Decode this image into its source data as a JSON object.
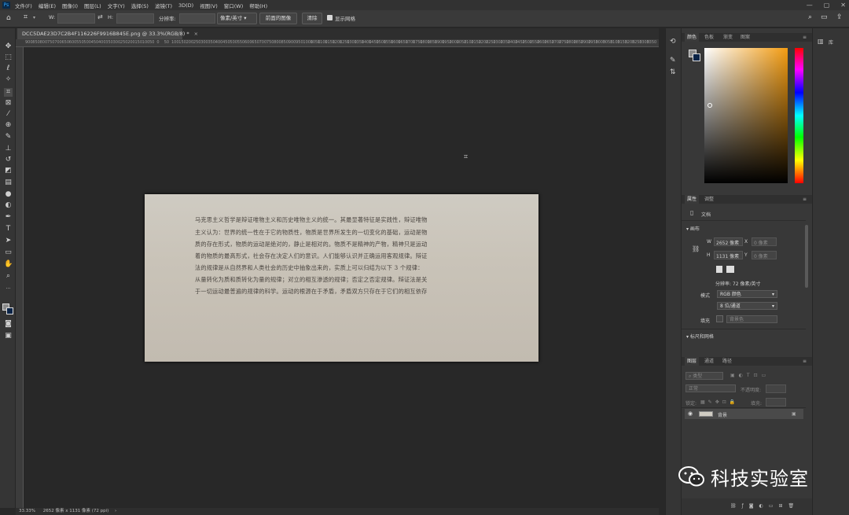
{
  "menu": {
    "items": [
      "文件(F)",
      "编辑(E)",
      "图像(I)",
      "图层(L)",
      "文字(Y)",
      "选择(S)",
      "滤镜(T)",
      "3D(D)",
      "视图(V)",
      "窗口(W)",
      "帮助(H)"
    ]
  },
  "options": {
    "w_label": "W:",
    "h_label": "H:",
    "resolution_label": "分辨率:",
    "unit_select": "像素/英寸",
    "front_image_button": "前面的图像",
    "clear_button": "清除",
    "show_grid_label": "显示网格"
  },
  "document": {
    "tab_title": "DCC5DAE23D7C2B4F116226F9916B845E.png @ 33.3%(RGB/8) *",
    "lines": [
      "马克思主义哲学是辩证唯物主义和历史唯物主义的统一。其最显著特征是实践性，辩证唯物",
      "主义认为：世界的统一性在于它的物质性，物质是世界所发生的一切变化的基础，运动是物",
      "质的存在形式，物质的运动是绝对的，静止是相对的。物质不是精神的产物，精神只是运动",
      "着的物质的最高形式，社会存在决定人们的意识。人们能够认识并正确运用客观规律。辩证",
      "法的规律是从自然界和人类社会的历史中抽象出来的，实质上可以归结为以下 3 个规律：",
      "从量转化为质和质转化为量的规律；对立的相互渗透的规律；否定之否定规律。辩证法是关",
      "于一切运动最普遍的规律的科学。运动的根源在于矛盾，矛盾双方只存在于它们的相互依存"
    ]
  },
  "ruler_ticks": [
    "900",
    "850",
    "800",
    "750",
    "700",
    "650",
    "600",
    "550",
    "500",
    "450",
    "400",
    "350",
    "300",
    "250",
    "200",
    "150",
    "100",
    "50",
    "0",
    "50",
    "100",
    "150",
    "200",
    "250",
    "300",
    "350",
    "400",
    "450",
    "500",
    "550",
    "600",
    "650",
    "700",
    "750",
    "800",
    "850",
    "900",
    "950",
    "1000",
    "1050",
    "1100",
    "1150",
    "1200",
    "1250",
    "1300",
    "1350",
    "1400",
    "1450",
    "1500",
    "1550",
    "1600",
    "1650",
    "1700",
    "1750",
    "1800",
    "1850",
    "1900",
    "1950",
    "2000",
    "2050",
    "2100",
    "2150",
    "2200",
    "2250",
    "2300",
    "2350",
    "2400",
    "2450",
    "2500",
    "2550",
    "2600",
    "2650",
    "2700",
    "2750",
    "2800",
    "2850",
    "2900",
    "2950",
    "3000",
    "3050",
    "3100",
    "3150",
    "3200",
    "3250",
    "3300",
    "3350",
    "3400",
    "3450",
    "3500",
    "3550",
    "3600"
  ],
  "status": {
    "zoom": "33.33%",
    "doc_size": "2652 像素 x 1131 像素 (72 ppi)"
  },
  "color_panel": {
    "tabs": [
      "颜色",
      "色板",
      "渐变",
      "图案"
    ]
  },
  "properties_panel": {
    "tabs": [
      "属性",
      "调整"
    ],
    "doc_label": "文档",
    "canvas_section": "画布",
    "w_label": "W",
    "w_value": "2652 像素",
    "x_label": "X",
    "x_placeholder": "0 像素",
    "h_label": "H",
    "h_value": "1131 像素",
    "y_label": "Y",
    "y_placeholder": "0 像素",
    "resolution": "分辨率: 72 像素/英寸",
    "mode_label": "模式",
    "mode_value": "RGB 颜色",
    "depth_value": "8 位/通道",
    "fill_label": "填充",
    "fill_value": "背景色",
    "rulers_section": "标尺和网格"
  },
  "layers_panel": {
    "tabs": [
      "图层",
      "通道",
      "路径"
    ],
    "filter_label": "类型",
    "blend_mode": "正常",
    "opacity_label": "不透明度:",
    "lock_label": "锁定:",
    "fill_label": "填充:",
    "layer_name": "背景"
  },
  "right_strip": {
    "labels": [
      "库"
    ]
  },
  "watermark": {
    "text": "科技实验室"
  }
}
